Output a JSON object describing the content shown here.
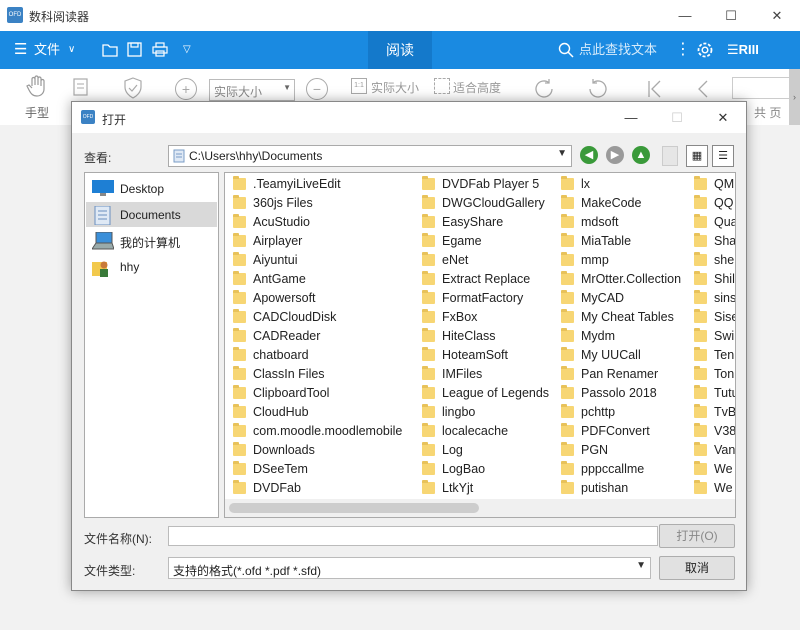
{
  "app": {
    "logo": "OFD",
    "title": "数科阅读器",
    "minimize": "—",
    "maximize": "☐",
    "close": "✕"
  },
  "menubar": {
    "file_label": "文件",
    "read_tab": "阅读",
    "search_placeholder": "点此查找文本",
    "accent": "#1a8ae1"
  },
  "toolbar": {
    "hand_label": "手型",
    "zoom_value": "实际大小",
    "actual_size": "实际大小",
    "fit_height": "适合高度",
    "total_pages": "共 页"
  },
  "dialog": {
    "logo": "OFD",
    "title": "打开",
    "look_in_label": "查看:",
    "look_in_path": "C:\\Users\\hhy\\Documents",
    "places": [
      {
        "label": "Desktop",
        "icon": "desktop-icon"
      },
      {
        "label": "Documents",
        "icon": "documents-icon",
        "selected": true
      },
      {
        "label": "我的计算机",
        "icon": "computer-icon"
      },
      {
        "label": "hhy",
        "icon": "user-folder-icon"
      }
    ],
    "columns": [
      [
        ".TeamyiLiveEdit",
        "360js Files",
        "AcuStudio",
        "Airplayer",
        "Aiyuntui",
        "AntGame",
        "Apowersoft",
        "CADCloudDisk",
        "CADReader",
        "chatboard",
        "ClassIn Files",
        "ClipboardTool",
        "CloudHub",
        "com.moodle.moodlemobile",
        "Downloads",
        "DSeeTem",
        "DVDFab"
      ],
      [
        "DVDFab Player 5",
        "DWGCloudGallery",
        "EasyShare",
        "Egame",
        "eNet",
        "Extract Replace",
        "FormatFactory",
        "FxBox",
        "HiteClass",
        "HoteamSoft",
        "IMFiles",
        "League of Legends",
        "lingbo",
        "localecache",
        "Log",
        "LogBao",
        "LtkYjt"
      ],
      [
        "lx",
        "MakeCode",
        "mdsoft",
        "MiaTable",
        "mmp",
        "MrOtter.Collection",
        "MyCAD",
        "My Cheat Tables",
        "Mydm",
        "My UUCall",
        "Pan Renamer",
        "Passolo 2018",
        "pchttp",
        "PDFConvert",
        "PGN",
        "pppccallme",
        "putishan"
      ],
      [
        "QM",
        "QQ",
        "Qua",
        "Sha",
        "she",
        "Shil",
        "sins",
        "Sise",
        "Swi",
        "Ten",
        "Ton",
        "Tutu",
        "TvB",
        "V38",
        "Van",
        "We",
        "We"
      ]
    ],
    "filename_label": "文件名称(N):",
    "filename_value": "",
    "filetype_label": "文件类型:",
    "filetype_value": "支持的格式(*.ofd *.pdf *.sfd)",
    "open_button": "打开(O)",
    "cancel_button": "取消"
  }
}
